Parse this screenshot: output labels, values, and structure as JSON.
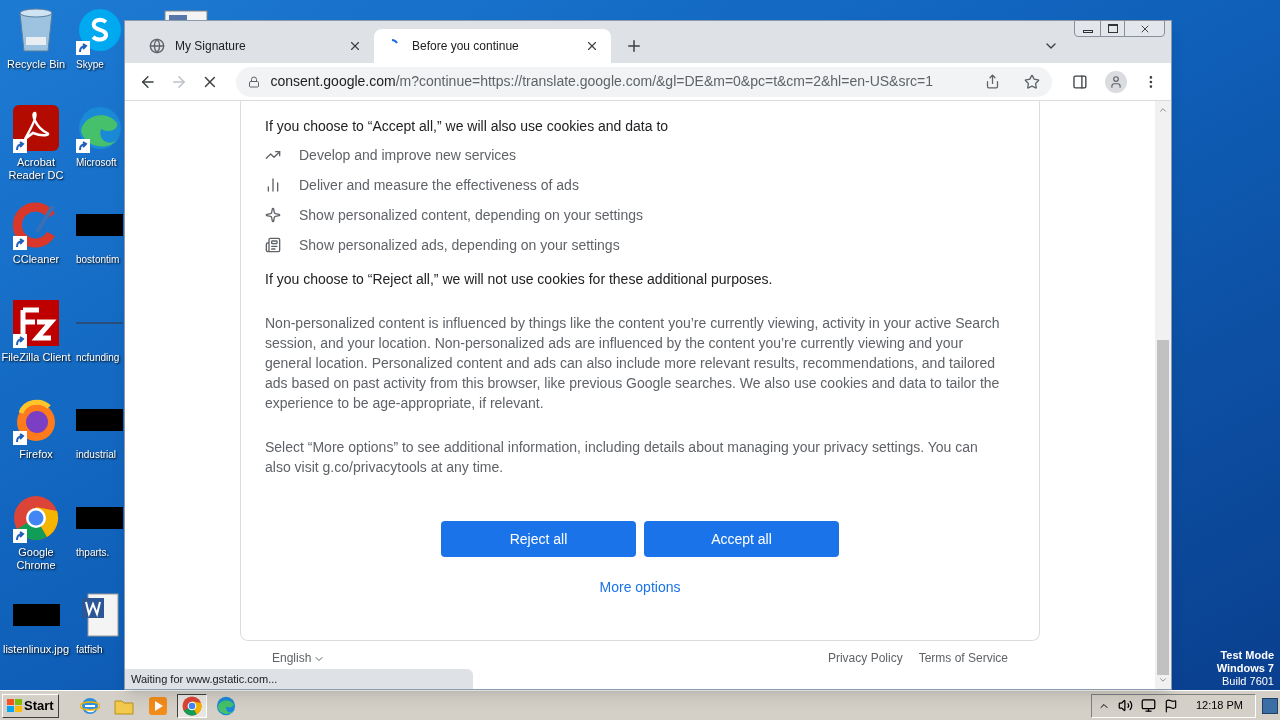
{
  "desktop": {
    "icons_column_1": [
      {
        "label": "Recycle Bin",
        "kind": "recycle",
        "shortcut": false
      },
      {
        "label": "Acrobat Reader DC",
        "kind": "acrobat",
        "shortcut": true
      },
      {
        "label": "CCleaner",
        "kind": "ccleaner",
        "shortcut": true
      },
      {
        "label": "FileZilla Client",
        "kind": "filezilla",
        "shortcut": true
      },
      {
        "label": "Firefox",
        "kind": "firefox",
        "shortcut": true
      },
      {
        "label": "Google Chrome",
        "kind": "chrome",
        "shortcut": true
      },
      {
        "label": "listenlinux.jpg",
        "kind": "redacted",
        "shortcut": false
      }
    ],
    "icons_column_2": [
      {
        "label": "Skype",
        "kind": "skype",
        "shortcut": true
      },
      {
        "label": "Microsoft",
        "kind": "edge",
        "shortcut": true
      },
      {
        "label": "bostontim",
        "kind": "redacted",
        "shortcut": false
      },
      {
        "label": "ncfunding",
        "kind": "line",
        "shortcut": false
      },
      {
        "label": "industrial",
        "kind": "redacted",
        "shortcut": false
      },
      {
        "label": "thparts.",
        "kind": "redacted",
        "shortcut": false
      },
      {
        "label": "fatfish",
        "kind": "word",
        "shortcut": false
      }
    ],
    "icons_column_3": [
      {
        "kind": "file"
      }
    ],
    "system_notice": [
      "Test Mode",
      "Windows 7",
      "Build 7601"
    ]
  },
  "browser": {
    "tabs": [
      {
        "title": "My Signature",
        "selected": false,
        "loading": false
      },
      {
        "title": "Before you continue",
        "selected": true,
        "loading": true
      }
    ],
    "toolbar": {
      "forward_disabled": true,
      "loading": true
    },
    "address": {
      "host": "consent.google.com",
      "path": "/m?continue=https://translate.google.com/&gl=DE&m=0&pc=t&cm=2&hl=en-US&src=1"
    },
    "page": {
      "intro": "If you choose to “Accept all,” we will also use cookies and data to",
      "purposes": [
        {
          "kind": "trend",
          "text": "Develop and improve new services"
        },
        {
          "kind": "bars",
          "text": "Deliver and measure the effectiveness of ads"
        },
        {
          "kind": "sparkle",
          "text": "Show personalized content, depending on your settings"
        },
        {
          "kind": "ads",
          "text": "Show personalized ads, depending on your settings"
        }
      ],
      "reject_note": "If you choose to “Reject all,” we will not use cookies for these additional purposes.",
      "paragraphs": [
        "Non-personalized content is influenced by things like the content you’re currently viewing, activity in your active Search session, and your location. Non-personalized ads are influenced by the content you’re currently viewing and your general location. Personalized content and ads can also include more relevant results, recommendations, and tailored ads based on past activity from this browser, like previous Google searches. We also use cookies and data to tailor the experience to be age-appropriate, if relevant.",
        "Select “More options” to see additional information, including details about managing your privacy settings. You can also visit g.co/privacytools at any time."
      ],
      "buttons": [
        "Reject all",
        "Accept all"
      ],
      "more_options": "More options",
      "footer": {
        "language": "English",
        "links": [
          "Privacy Policy",
          "Terms of Service"
        ]
      }
    },
    "status_bubble": "Waiting for www.gstatic.com..."
  },
  "taskbar": {
    "start": "Start",
    "quick_launch": [
      {
        "kind": "ie",
        "active": false
      },
      {
        "kind": "folder",
        "active": false
      },
      {
        "kind": "media",
        "active": false
      },
      {
        "kind": "chrome",
        "active": true
      },
      {
        "kind": "edge",
        "active": false
      }
    ],
    "clock": "12:18 PM"
  }
}
